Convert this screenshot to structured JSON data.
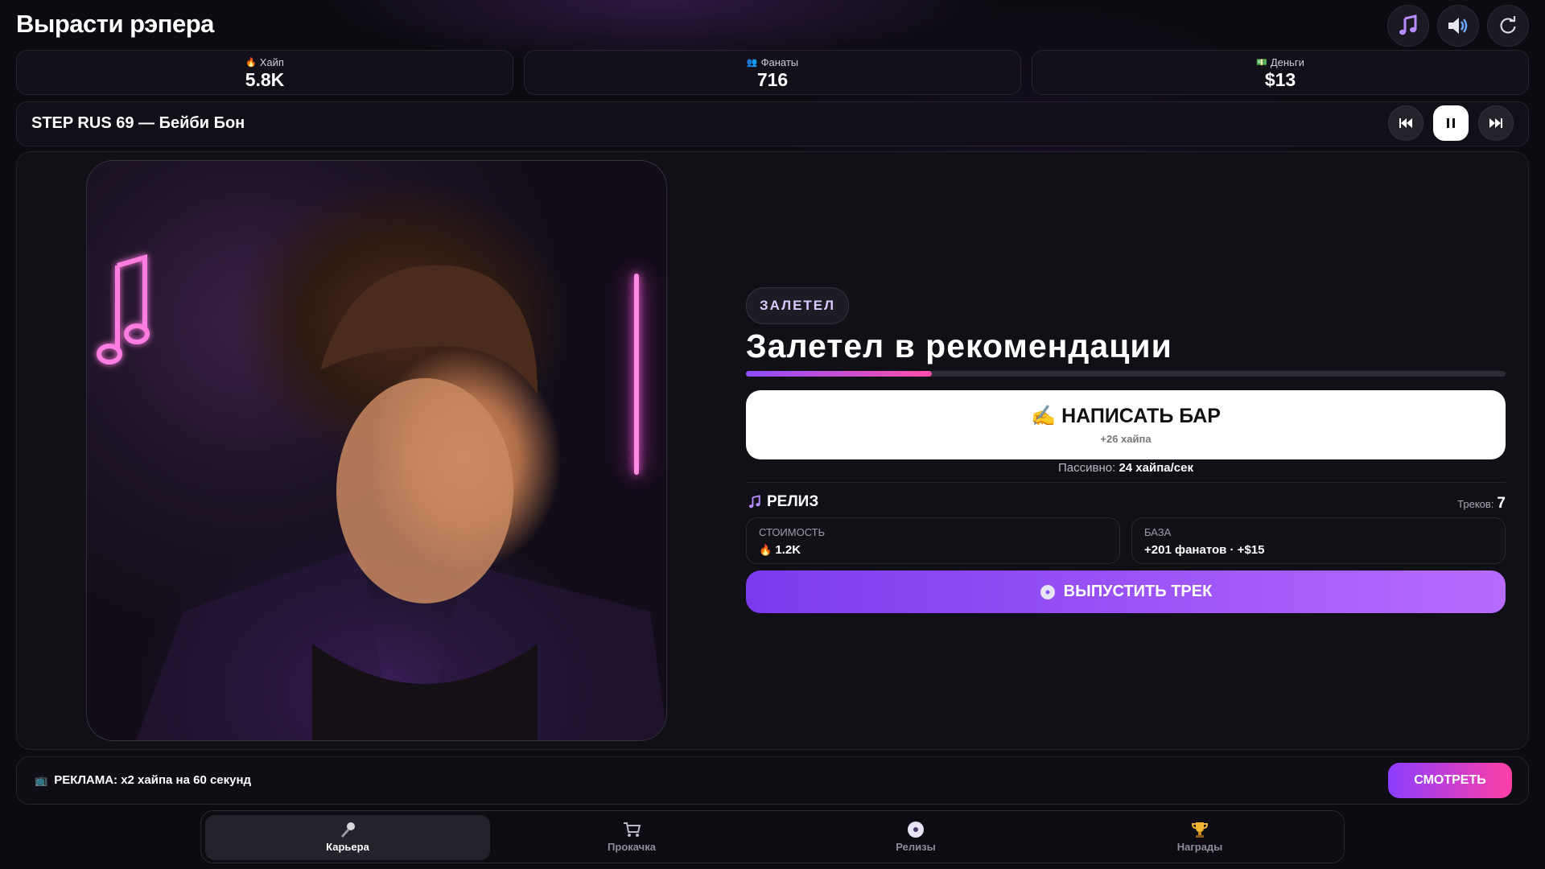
{
  "app": {
    "title": "Вырасти рэпера"
  },
  "top_icons": [
    "music-note-icon",
    "speaker-icon",
    "refresh-icon"
  ],
  "stats": [
    {
      "label": "Хайп",
      "value": "5.8K",
      "icon": "fire-icon"
    },
    {
      "label": "Фанаты",
      "value": "716",
      "icon": "people-icon"
    },
    {
      "label": "Деньги",
      "value": "$13",
      "icon": "money-icon"
    }
  ],
  "player": {
    "track": "STEP RUS 69 — Бейби Бон",
    "controls": [
      "previous-icon",
      "pause-icon",
      "next-icon"
    ]
  },
  "main": {
    "badge": "ЗАЛЕТЕЛ",
    "headline": "Залетел в рекомендации",
    "progress": 0.245,
    "write_button": {
      "label": "НАПИСАТЬ БАР",
      "sub": "+26 хайпа",
      "emoji": "✍️"
    },
    "passive": {
      "label": "Пассивно:",
      "value": "24 хайпа/сек"
    },
    "release": {
      "title": "РЕЛИЗ",
      "tracks_label": "Треков:",
      "tracks_value": "7",
      "cost_label": "СТОИМОСТЬ",
      "cost_value": "1.2K",
      "base_label": "БАЗА",
      "base_value": "+201 фанатов · +$15",
      "button_label": "ВЫПУСТИТЬ ТРЕК"
    }
  },
  "ad": {
    "text": "РЕКЛАМА: x2 хайпа на 60 секунд",
    "button": "СМОТРЕТЬ"
  },
  "nav": [
    {
      "label": "Карьера",
      "icon": "microphone-icon",
      "active": true
    },
    {
      "label": "Прокачка",
      "icon": "cart-icon",
      "active": false
    },
    {
      "label": "Релизы",
      "icon": "disc-icon",
      "active": false
    },
    {
      "label": "Награды",
      "icon": "trophy-icon",
      "active": false
    }
  ],
  "colors": {
    "accent_purple": "#7c3aed",
    "accent_pink": "#ff4fa8",
    "background": "#0c0b11"
  }
}
